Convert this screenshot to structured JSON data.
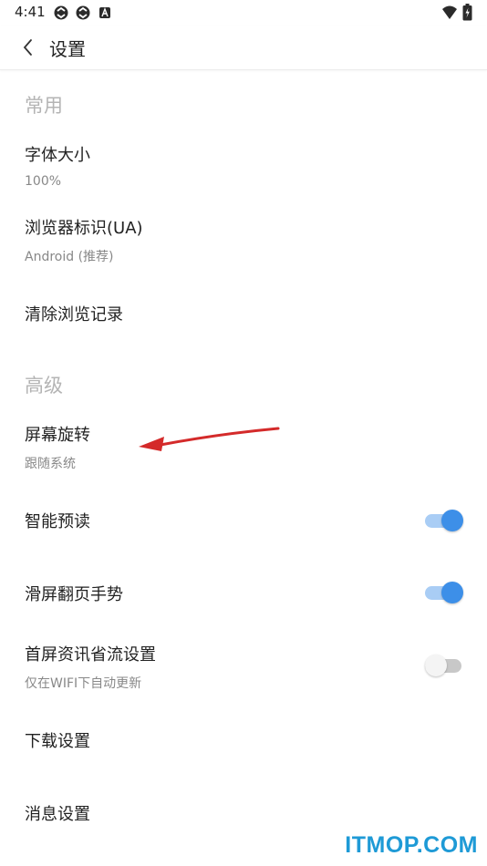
{
  "status_bar": {
    "time": "4:41",
    "icons": [
      "sync-icon",
      "sync-icon",
      "app-notification-icon",
      "wifi-icon",
      "battery-icon"
    ]
  },
  "app_bar": {
    "title": "设置",
    "back_icon": "chevron-left-icon"
  },
  "sections": [
    {
      "header": "常用",
      "items": [
        {
          "title": "字体大小",
          "subtitle": "100%"
        },
        {
          "title": "浏览器标识(UA)",
          "subtitle": "Android (推荐)"
        },
        {
          "title": "清除浏览记录"
        }
      ]
    },
    {
      "header": "高级",
      "items": [
        {
          "title": "屏幕旋转",
          "subtitle": "跟随系统"
        },
        {
          "title": "智能预读",
          "toggle": true
        },
        {
          "title": "滑屏翻页手势",
          "toggle": true
        },
        {
          "title": "首屏资讯省流设置",
          "subtitle": "仅在WIFI下自动更新",
          "toggle": false
        },
        {
          "title": "下载设置"
        },
        {
          "title": "消息设置"
        }
      ]
    }
  ],
  "colors": {
    "accent": "#3d8fe8",
    "track_on": "#a9cdf5",
    "section_header": "#b4b4b4",
    "annotation_arrow": "#d42a2a"
  },
  "watermark": "ITMOP.COM"
}
